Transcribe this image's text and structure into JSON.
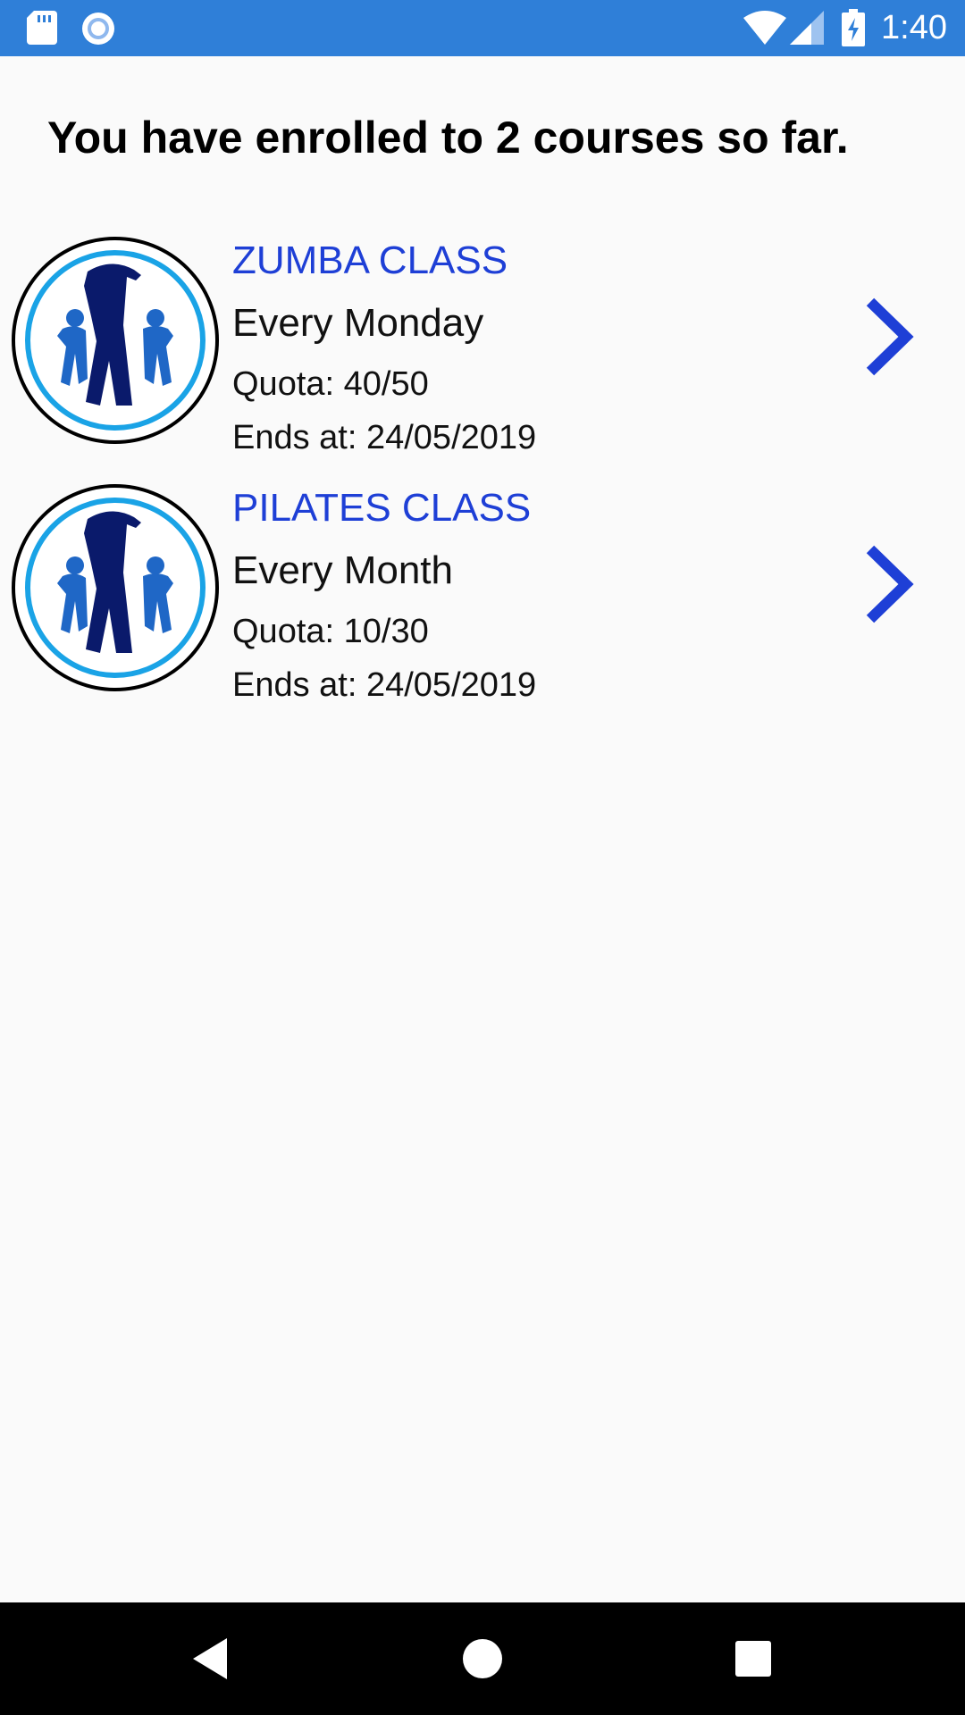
{
  "status_bar": {
    "time": "1:40",
    "icons": [
      "sd-card-icon",
      "sync-icon",
      "wifi-icon",
      "signal-icon",
      "battery-charging-icon"
    ]
  },
  "header": {
    "text": "You have enrolled to 2 courses so far."
  },
  "courses": [
    {
      "title": "ZUMBA CLASS",
      "schedule": "Every Monday",
      "quota": "Quota: 40/50",
      "ends": "Ends at: 24/05/2019",
      "icon": "fitness-class-icon"
    },
    {
      "title": "PILATES CLASS",
      "schedule": "Every Month",
      "quota": "Quota: 10/30",
      "ends": "Ends at: 24/05/2019",
      "icon": "fitness-class-icon"
    }
  ],
  "nav_bar": {
    "icons": [
      "back-icon",
      "home-icon",
      "recents-icon"
    ]
  },
  "colors": {
    "status_bar": "#2f7fd8",
    "accent": "#1e3fd6",
    "background": "#fafafa",
    "nav_bar": "#000000"
  }
}
